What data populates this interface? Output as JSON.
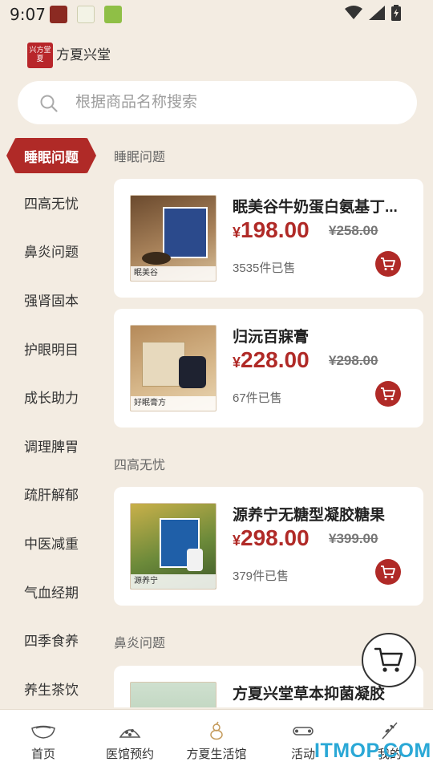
{
  "status_bar": {
    "time": "9:07"
  },
  "brand": {
    "name": "方夏兴堂",
    "mark": "兴方堂夏"
  },
  "search": {
    "placeholder": "根据商品名称搜索"
  },
  "sidebar": {
    "items": [
      {
        "label": "睡眠问题",
        "active": true
      },
      {
        "label": "四高无忧"
      },
      {
        "label": "鼻炎问题"
      },
      {
        "label": "强肾固本"
      },
      {
        "label": "护眼明目"
      },
      {
        "label": "成长助力"
      },
      {
        "label": "调理脾胃"
      },
      {
        "label": "疏肝解郁"
      },
      {
        "label": "中医减重"
      },
      {
        "label": "气血经期"
      },
      {
        "label": "四季食养"
      },
      {
        "label": "养生茶饮"
      }
    ]
  },
  "main": {
    "sections": [
      {
        "title": "睡眠问题",
        "products": [
          {
            "name": "眠美谷牛奶蛋白氨基丁...",
            "currency": "¥",
            "price": "198.00",
            "old_price": "¥258.00",
            "sold": "3535件已售",
            "img_label": "眠美谷"
          },
          {
            "name": "归沅百寐膏",
            "currency": "¥",
            "price": "228.00",
            "old_price": "¥298.00",
            "sold": "67件已售",
            "img_label": "好眠膏方"
          }
        ]
      },
      {
        "title": "四高无忧",
        "products": [
          {
            "name": "源养宁无糖型凝胶糖果",
            "currency": "¥",
            "price": "298.00",
            "old_price": "¥399.00",
            "sold": "379件已售",
            "img_label": "源养宁"
          }
        ]
      },
      {
        "title": "鼻炎问题",
        "products": [
          {
            "name": "方夏兴堂草本抑菌凝胶"
          }
        ]
      }
    ]
  },
  "bottom_nav": {
    "items": [
      {
        "label": "首页",
        "icon": "bowl-icon"
      },
      {
        "label": "医馆预约",
        "icon": "herb-pile-icon"
      },
      {
        "label": "方夏生活馆",
        "icon": "gourd-icon"
      },
      {
        "label": "活动",
        "icon": "scroll-icon"
      },
      {
        "label": "我的",
        "icon": "branch-icon"
      }
    ]
  },
  "watermark": "ITMOP.COM",
  "colors": {
    "accent": "#b02a27",
    "background": "#f3ece2",
    "card": "#ffffff"
  }
}
